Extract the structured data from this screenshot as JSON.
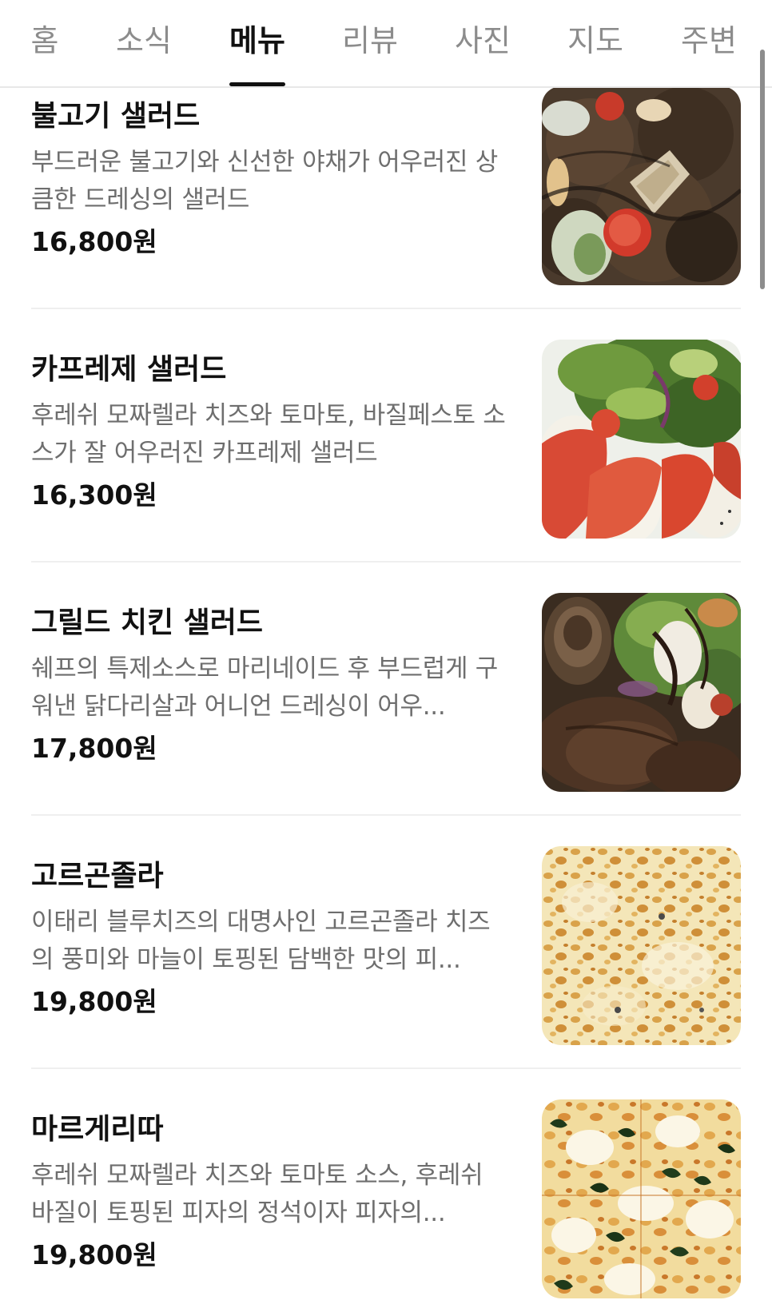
{
  "tabs": [
    {
      "label": "홈",
      "active": false
    },
    {
      "label": "소식",
      "active": false
    },
    {
      "label": "메뉴",
      "active": true
    },
    {
      "label": "리뷰",
      "active": false
    },
    {
      "label": "사진",
      "active": false
    },
    {
      "label": "지도",
      "active": false
    },
    {
      "label": "주변",
      "active": false
    }
  ],
  "menu": {
    "items": [
      {
        "name": "불고기 샐러드",
        "description": "부드러운 불고기와 신선한 야채가 어우러진 상큼한 드레싱의 샐러드",
        "price": "16,800원",
        "image": "bulgogi-salad-photo"
      },
      {
        "name": "카프레제 샐러드",
        "description": "후레쉬 모짜렐라 치즈와 토마토, 바질페스토 소스가 잘 어우러진 카프레제 샐러드",
        "price": "16,300원",
        "image": "caprese-salad-photo"
      },
      {
        "name": "그릴드 치킨 샐러드",
        "description": "쉐프의 특제소스로 마리네이드 후 부드럽게 구워낸 닭다리살과 어니언 드레싱이 어우...",
        "price": "17,800원",
        "image": "grilled-chicken-salad-photo"
      },
      {
        "name": "고르곤졸라",
        "description": "이태리 블루치즈의 대명사인 고르곤졸라 치즈의 풍미와 마늘이 토핑된 담백한 맛의 피...",
        "price": "19,800원",
        "image": "gorgonzola-pizza-photo"
      },
      {
        "name": "마르게리따",
        "description": "후레쉬 모짜렐라 치즈와 토마토 소스, 후레쉬 바질이 토핑된 피자의 정석이자 피자의...",
        "price": "19,800원",
        "image": "margherita-pizza-photo"
      }
    ]
  },
  "colors": {
    "text_primary": "#111111",
    "text_secondary": "#6e6e6e",
    "tab_inactive": "#8c8c8c",
    "divider": "#efefef"
  }
}
